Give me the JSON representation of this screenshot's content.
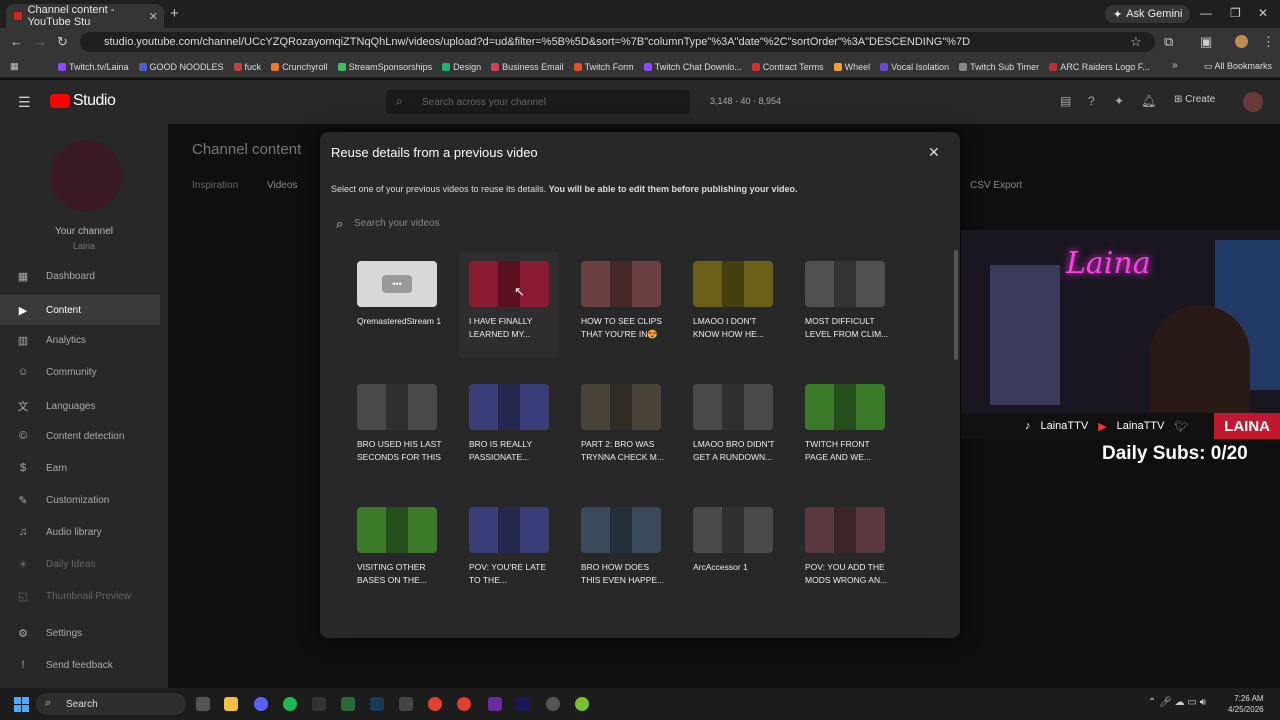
{
  "browser": {
    "tab_title": "Channel content - YouTube Stu",
    "ask_gemini": "Ask Gemini",
    "url": "studio.youtube.com/channel/UCcYZQRozayomqiZTNqQhLnw/videos/upload?d=ud&filter=%5B%5D&sort=%7B\"columnType\"%3A\"date\"%2C\"sortOrder\"%3A\"DESCENDING\"%7D",
    "bookmarks": [
      "Twitch.tv/Laina",
      "GOOD NOODLES",
      "fuck",
      "Crunchyroll",
      "StreamSponsorships",
      "Design",
      "Business Email",
      "Twitch Form",
      "Twitch Chat Downlo...",
      "Contract Terms",
      "Wheel",
      "Vocal Isolation",
      "Twitch Sub Timer",
      "ARC Raiders Logo F..."
    ],
    "all_bookmarks": "All Bookmarks"
  },
  "studio": {
    "logo": "Studio",
    "search_placeholder": "Search across your channel",
    "stats": "3,148  ·  40  ·  8,954",
    "create": "Create"
  },
  "sidebar": {
    "your_channel": "Your channel",
    "channel_name": "Laina",
    "items": [
      {
        "label": "Dashboard",
        "icon": "dashboard-icon"
      },
      {
        "label": "Content",
        "icon": "content-icon"
      },
      {
        "label": "Analytics",
        "icon": "analytics-icon"
      },
      {
        "label": "Community",
        "icon": "community-icon"
      },
      {
        "label": "Languages",
        "icon": "languages-icon"
      },
      {
        "label": "Content detection",
        "icon": "copyright-icon"
      },
      {
        "label": "Earn",
        "icon": "earn-icon"
      },
      {
        "label": "Customization",
        "icon": "customization-icon"
      },
      {
        "label": "Audio library",
        "icon": "audio-icon"
      },
      {
        "label": "Daily Ideas",
        "icon": "ideas-icon"
      },
      {
        "label": "Thumbnail Preview",
        "icon": "preview-icon"
      },
      {
        "label": "Settings",
        "icon": "settings-icon"
      },
      {
        "label": "Send feedback",
        "icon": "feedback-icon"
      }
    ]
  },
  "page": {
    "title": "Channel content",
    "tabs": [
      "Inspiration",
      "Videos"
    ],
    "csv_export": "CSV Export"
  },
  "modal": {
    "title": "Reuse details from a previous video",
    "description_plain": "Select one of your previous videos to reuse its details.",
    "description_bold": "You will be able to edit them before publishing your video.",
    "search_placeholder": "Search your videos",
    "videos": [
      {
        "title": "QremasteredStream 1",
        "color": "#d8d8d8"
      },
      {
        "title": "I HAVE FINALLY LEARNED MY...",
        "color": "#8a1a30"
      },
      {
        "title": "HOW TO SEE CLIPS THAT YOU'RE IN😍",
        "color": "#6a4040"
      },
      {
        "title": "LMAOO I DON'T KNOW HOW HE...",
        "color": "#6a6018"
      },
      {
        "title": "MOST DIFFICULT LEVEL FROM CLIM...",
        "color": "#505050"
      },
      {
        "title": "BRO USED HIS LAST SECONDS FOR THIS",
        "color": "#4a4a4a"
      },
      {
        "title": "BRO IS REALLY PASSIONATE...",
        "color": "#3a3e78"
      },
      {
        "title": "PART 2: BRO WAS TRYNNA CHECK M...",
        "color": "#4a4438"
      },
      {
        "title": "LMAOO BRO DIDN'T GET A RUNDOWN...",
        "color": "#4a4a4a"
      },
      {
        "title": "TWITCH FRONT PAGE AND WE...",
        "color": "#3a7a28"
      },
      {
        "title": "VISITING OTHER BASES ON THE...",
        "color": "#3a7a28"
      },
      {
        "title": "POV: YOU'RE LATE TO THE...",
        "color": "#3a3e78"
      },
      {
        "title": "BRO HOW DOES THIS EVEN HAPPE...",
        "color": "#3a4a5a"
      },
      {
        "title": "ArcAccessor 1",
        "color": "#4a4a4a"
      },
      {
        "title": "POV: YOU ADD THE MODS WRONG AN...",
        "color": "#5a3a40"
      }
    ]
  },
  "stream_overlay": {
    "neon_sign": "Laina",
    "tiktok": "LainaTTV",
    "youtube": "LainaTTV",
    "brand": "LAINA",
    "daily_subs": "Daily Subs: 0/20"
  },
  "taskbar": {
    "search": "Search",
    "time": "7:26 AM",
    "date": "4/25/2026"
  }
}
